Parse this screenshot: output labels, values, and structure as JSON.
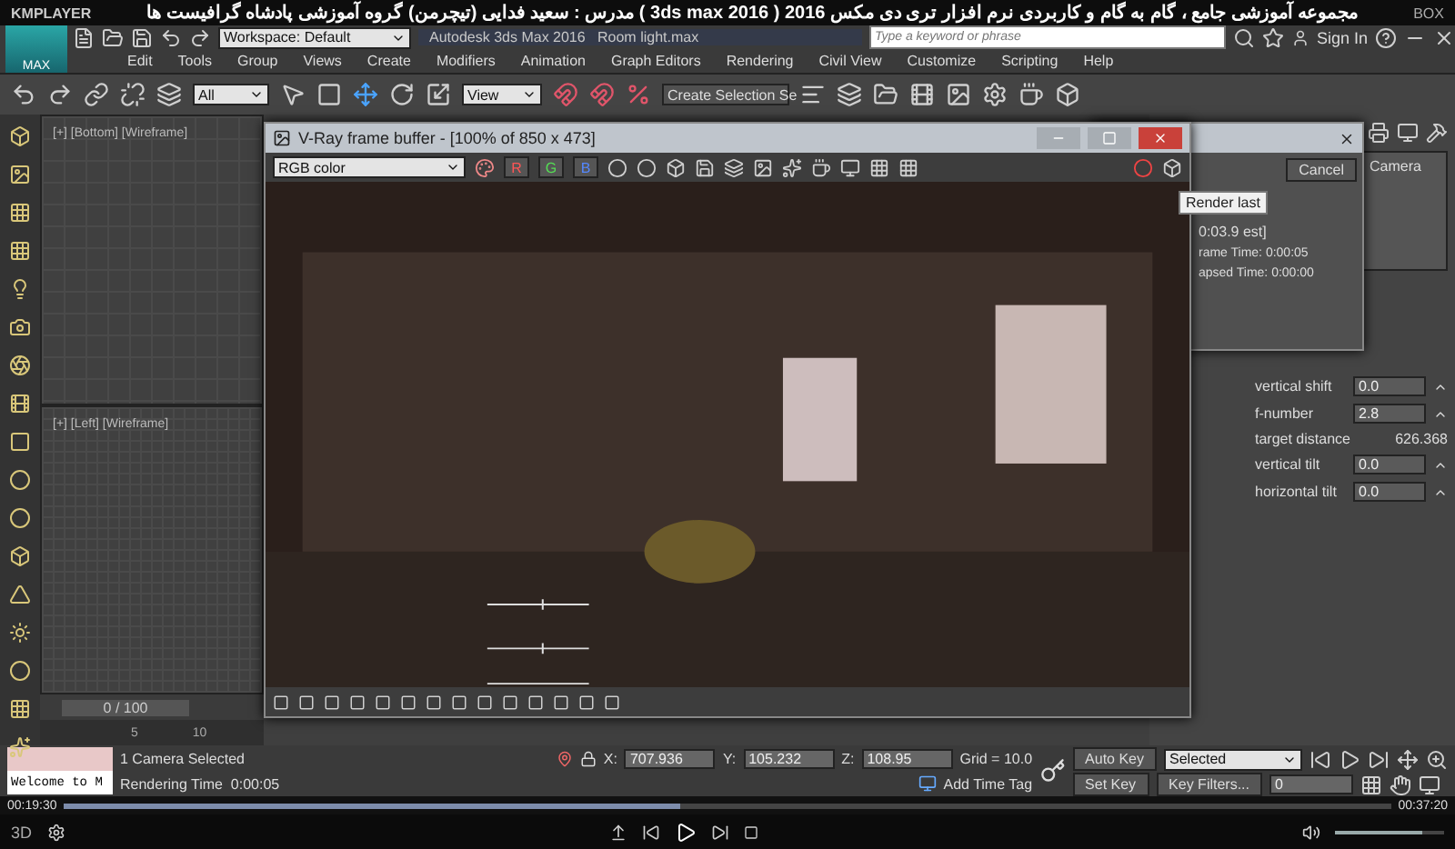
{
  "player": {
    "brand": "KMPLAYER",
    "title": "مجموعه آموزشی جامع ، گام به گام و کاربردی نرم افزار تری دی مکس 2016 ( 3ds max 2016 ) مدرس : سعید فدایی (تیچرمن) گروه آموزشی پادشاه گرافیست ها",
    "box_label": "BOX",
    "time_elapsed": "00:19:30",
    "time_total": "00:37:20",
    "progress": {
      "level": 0.465
    },
    "volume": {
      "level": 0.8
    },
    "mode_label": "3D"
  },
  "max": {
    "logo": "MAX",
    "workspace": "Workspace: Default",
    "title": "Autodesk 3ds Max 2016   Room light.max",
    "search": {
      "placeholder": "Type a keyword or phrase"
    },
    "sign_in": "Sign In",
    "menu": [
      "Edit",
      "Tools",
      "Group",
      "Views",
      "Create",
      "Modifiers",
      "Animation",
      "Graph Editors",
      "Rendering",
      "Civil View",
      "Customize",
      "Scripting",
      "Help"
    ],
    "toolbar": {
      "selection_filter": "All",
      "reference_coord": "View",
      "named_selection": "Create Selection Se"
    },
    "viewports": [
      {
        "label": "[+] [Bottom] [Wireframe]"
      },
      {
        "label": "[+] [Left] [Wireframe]"
      }
    ],
    "time_slider": "0 / 100",
    "track_ticks": [
      "5",
      "10"
    ],
    "vfb": {
      "title": "V-Ray frame buffer - [100% of 850 x 473]",
      "channel": "RGB color",
      "channel_buttons": [
        "R",
        "G",
        "B"
      ],
      "tooltip": "Render last"
    },
    "render_dialog": {
      "cancel": "Cancel",
      "estimate": "0:03.9 est]",
      "times": [
        {
          "label": "rame Time:",
          "value": "0:00:05"
        },
        {
          "label": "apsed Time:",
          "value": "0:00:00"
        }
      ]
    },
    "command_panel": {
      "list_item": "Camera",
      "params": [
        {
          "kind": "spinner",
          "label": "vertical shift",
          "value": "0.0"
        },
        {
          "kind": "spinner",
          "label": "f-number",
          "value": "2.8"
        },
        {
          "kind": "readout",
          "label": "target distance",
          "value": "626.368"
        },
        {
          "kind": "spinner",
          "label": "vertical tilt",
          "value": "0.0"
        },
        {
          "kind": "spinner",
          "label": "horizontal tilt",
          "value": "0.0"
        }
      ]
    },
    "status": {
      "listener": "Welcome to M",
      "selection": "1 Camera Selected",
      "prompt": "Rendering Time  0:00:05",
      "coords": [
        {
          "label": "X:",
          "value": "707.936"
        },
        {
          "label": "Y:",
          "value": "105.232"
        },
        {
          "label": "Z:",
          "value": "108.95"
        }
      ],
      "grid": "Grid = 10.0",
      "add_time_tag": "Add Time Tag",
      "auto_key": "Auto Key",
      "key_mode": "Selected",
      "set_key": "Set Key",
      "key_filters": "Key Filters...",
      "frame": "0"
    }
  }
}
